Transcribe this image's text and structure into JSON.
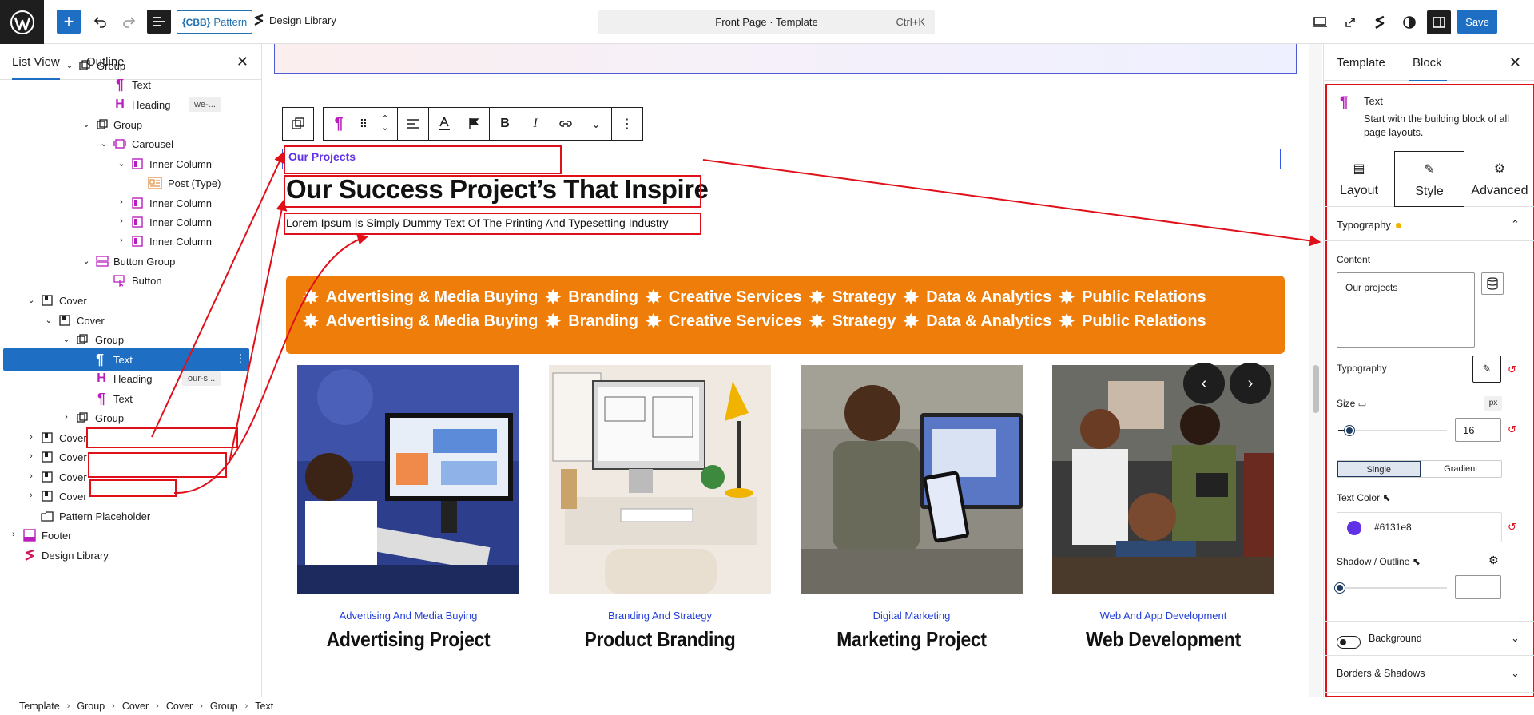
{
  "topbar": {
    "pattern_prefix": "{CBB}",
    "pattern_label": "Pattern",
    "library_label": "Design Library",
    "doc_title": "Front Page · Template",
    "doc_shortcut": "Ctrl+K",
    "save_label": "Save"
  },
  "list_view": {
    "tab_list": "List View",
    "tab_outline": "Outline",
    "rows": [
      {
        "label": "Group",
        "anchor": ""
      },
      {
        "label": "Text",
        "anchor": ""
      },
      {
        "label": "Heading",
        "anchor": "we-..."
      },
      {
        "label": "Group",
        "anchor": ""
      },
      {
        "label": "Carousel",
        "anchor": ""
      },
      {
        "label": "Inner Column",
        "anchor": ""
      },
      {
        "label": "Post (Type)",
        "anchor": ""
      },
      {
        "label": "Inner Column",
        "anchor": ""
      },
      {
        "label": "Inner Column",
        "anchor": ""
      },
      {
        "label": "Inner Column",
        "anchor": ""
      },
      {
        "label": "Button Group",
        "anchor": ""
      },
      {
        "label": "Button",
        "anchor": ""
      },
      {
        "label": "Cover",
        "anchor": ""
      },
      {
        "label": "Cover",
        "anchor": ""
      },
      {
        "label": "Group",
        "anchor": ""
      },
      {
        "label": "Text",
        "anchor": ""
      },
      {
        "label": "Heading",
        "anchor": "our-s..."
      },
      {
        "label": "Text",
        "anchor": ""
      },
      {
        "label": "Group",
        "anchor": ""
      },
      {
        "label": "Cover",
        "anchor": ""
      },
      {
        "label": "Cover",
        "anchor": ""
      },
      {
        "label": "Cover",
        "anchor": ""
      },
      {
        "label": "Cover",
        "anchor": ""
      },
      {
        "label": "Pattern Placeholder",
        "anchor": ""
      },
      {
        "label": "Footer",
        "anchor": ""
      },
      {
        "label": "Design Library",
        "anchor": ""
      }
    ]
  },
  "canvas": {
    "eyebrow": "Our Projects",
    "heading": "Our Success Project’s That Inspire",
    "lorem": "Lorem Ipsum Is Simply Dummy Text Of The Printing And Typesetting Industry",
    "marquee_items": [
      "Advertising & Media Buying",
      "Branding",
      "Creative Services",
      "Strategy",
      "Data & Analytics",
      "Public Relations"
    ],
    "cards": [
      {
        "category": "Advertising And Media Buying",
        "title": "Advertising Project"
      },
      {
        "category": "Branding And Strategy",
        "title": "Product Branding"
      },
      {
        "category": "Digital Marketing",
        "title": "Marketing Project"
      },
      {
        "category": "Web And App Development",
        "title": "Web Development"
      }
    ]
  },
  "inspector": {
    "tab_template": "Template",
    "tab_block": "Block",
    "block_name": "Text",
    "block_desc": "Start with the building block of all page layouts.",
    "subtabs": [
      "Layout",
      "Style",
      "Advanced"
    ],
    "typography_section": "Typography",
    "content_label": "Content",
    "content_value": "Our projects",
    "typography_label": "Typography",
    "size_label": "Size",
    "size_unit": "px",
    "size_value": "16",
    "size_level": 0.1,
    "fill_single": "Single",
    "fill_gradient": "Gradient",
    "text_color_label": "Text Color",
    "text_color_value": "#6131e8",
    "shadow_label": "Shadow / Outline",
    "background_label": "Background",
    "borders_label": "Borders & Shadows"
  },
  "breadcrumb": [
    "Template",
    "Group",
    "Cover",
    "Cover",
    "Group",
    "Text"
  ],
  "colors": {
    "accent": "#1e6fc4",
    "block_purple": "#b81ebd",
    "eyebrow": "#6131e8",
    "marquee": "#ef7d0a",
    "annotation": "#e0101a"
  }
}
